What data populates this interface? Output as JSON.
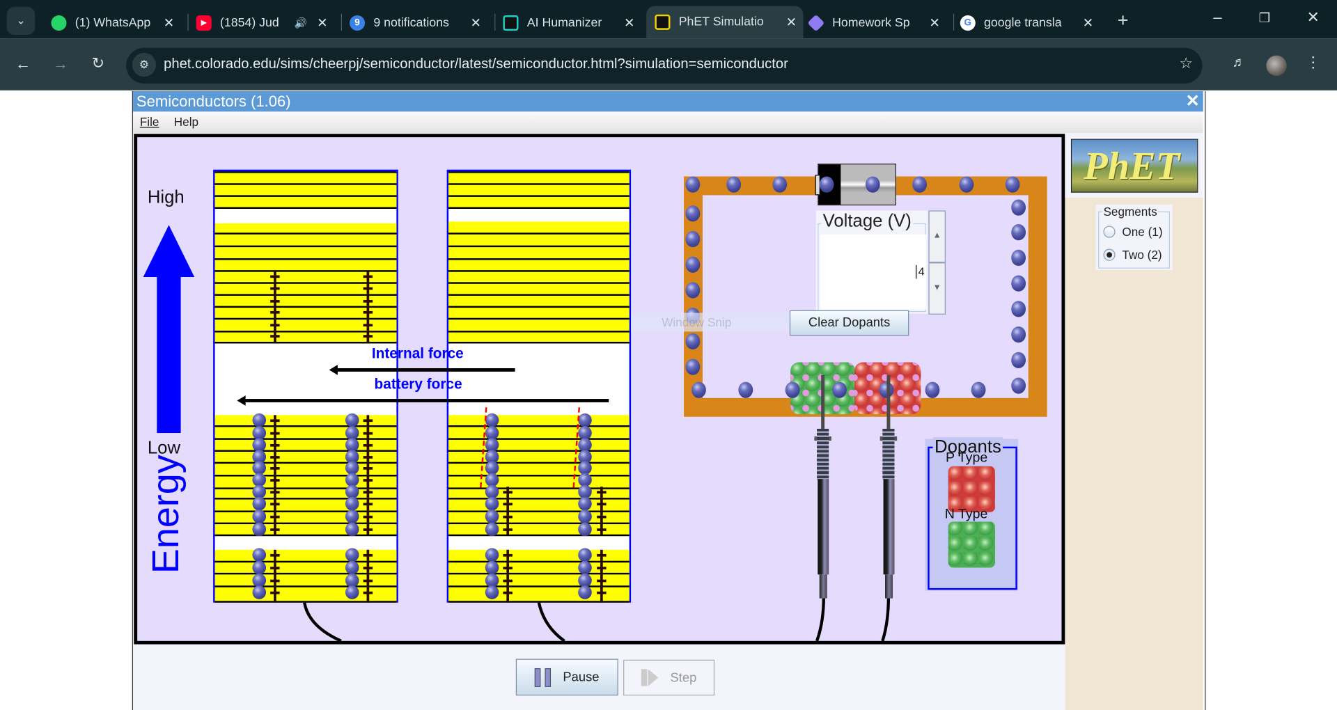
{
  "browser": {
    "tabs": [
      {
        "label": "(1) WhatsApp",
        "icon": "whatsapp-icon",
        "color": "#25d366"
      },
      {
        "label": "(1854) Jud",
        "icon": "youtube-icon",
        "color": "#ff0033",
        "audio": true
      },
      {
        "label": "9 notifications",
        "icon": "notifications-icon",
        "color": "#3b82e6",
        "badge": "9"
      },
      {
        "label": "AI Humanizer",
        "icon": "ai-humanizer-icon",
        "color": "#1bd1c4"
      },
      {
        "label": "PhET Simulatio",
        "icon": "phet-icon",
        "color": "#f2d400",
        "active": true
      },
      {
        "label": "Homework Sp",
        "icon": "homework-icon",
        "color": "#8f7cf2"
      },
      {
        "label": "google transla",
        "icon": "google-icon",
        "color": "#4285f4"
      }
    ],
    "new_tab": "+",
    "url": "phet.colorado.edu/sims/cheerpj/semiconductor/latest/semiconductor.html?simulation=semiconductor"
  },
  "app": {
    "title": "Semiconductors (1.06)",
    "menu": [
      "File",
      "Help"
    ],
    "colors": {
      "titlebar": "#5b9ad6",
      "canvas": "#e4dbfd",
      "band": "#ffff00",
      "wire": "#d8861a",
      "electron": "#43489a",
      "energy_arrow": "#0000ff"
    }
  },
  "sim": {
    "energy_high": "High",
    "energy_low": "Low",
    "energy_label": "Energy",
    "internal_force": "Internal force",
    "battery_force": "battery force",
    "voltage_title": "Voltage (V)",
    "voltage_value": "4",
    "clear_dopants": "Clear Dopants",
    "dopants_title": "Dopants",
    "p_type": "P Type",
    "n_type": "N Type",
    "overlay_text": "Window Snip"
  },
  "side": {
    "logo": "PhET",
    "segments_title": "Segments",
    "segments": [
      {
        "label": "One (1)",
        "selected": false
      },
      {
        "label": "Two (2)",
        "selected": true
      }
    ]
  },
  "controls": {
    "pause": "Pause",
    "step": "Step",
    "step_enabled": false
  }
}
